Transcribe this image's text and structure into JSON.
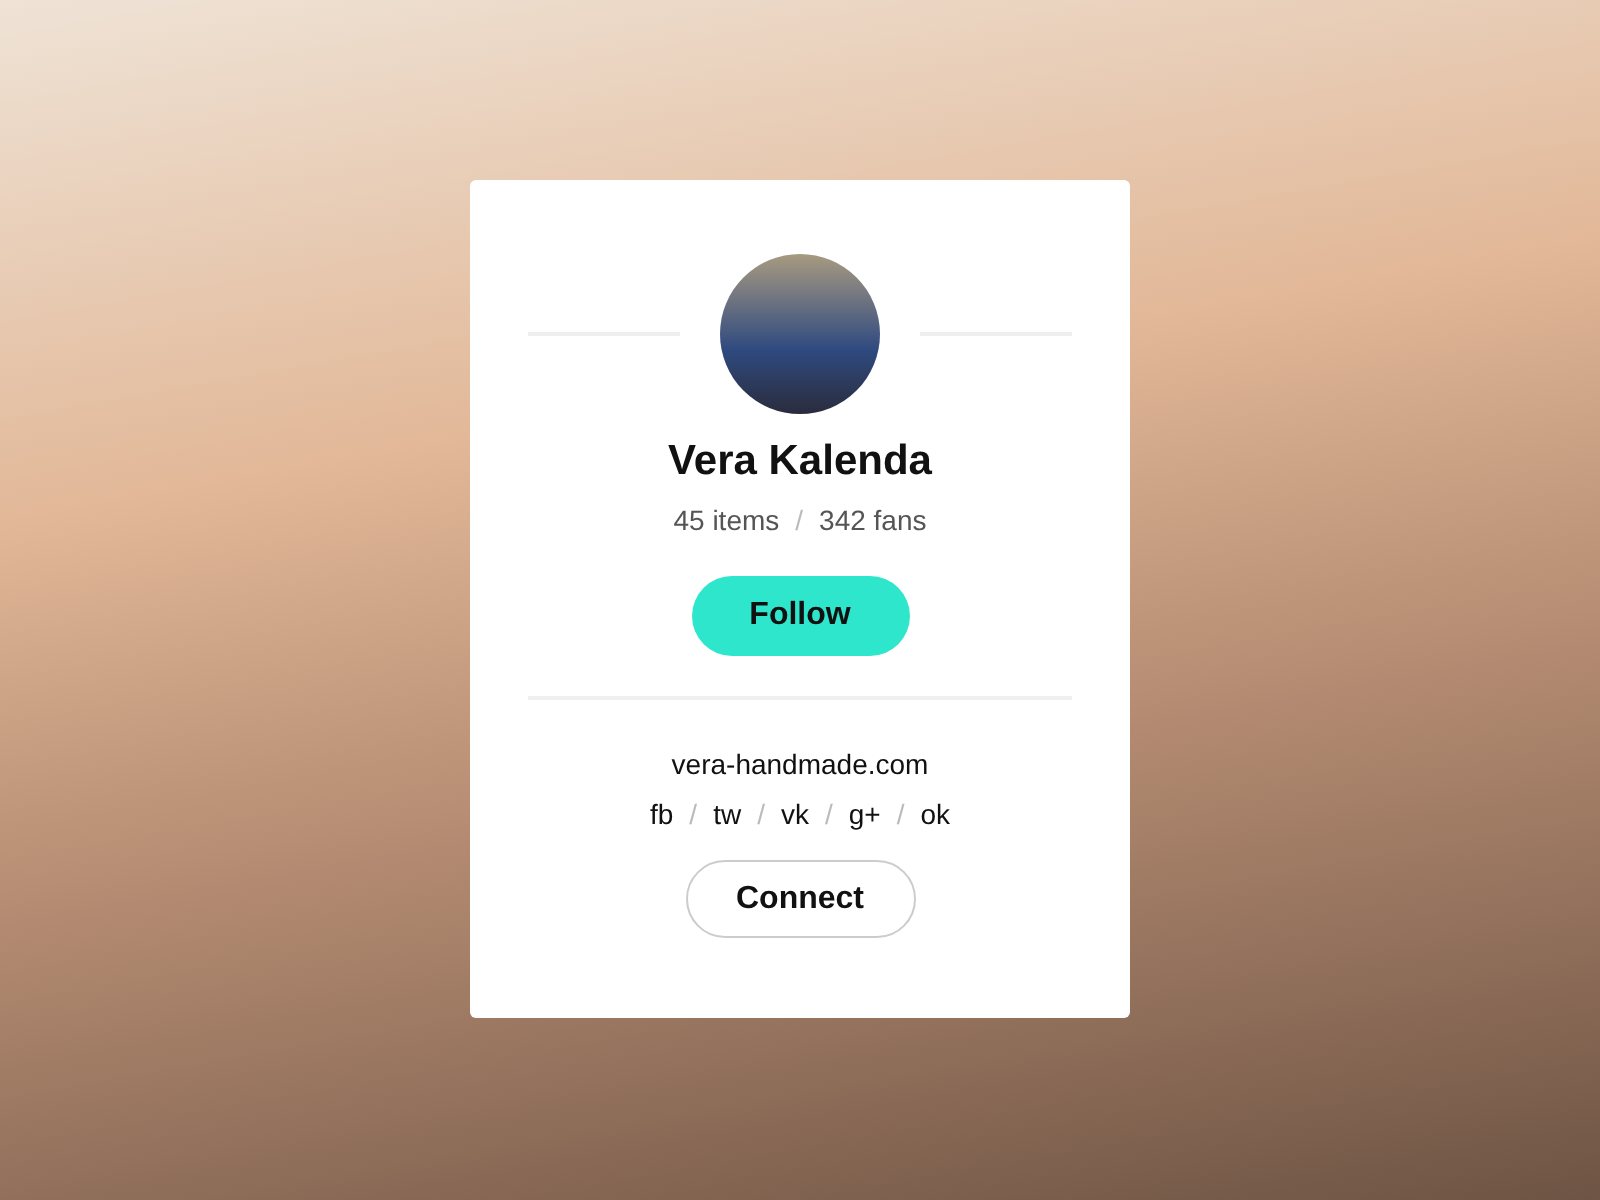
{
  "profile": {
    "name": "Vera Kalenda",
    "stats": [
      {
        "kind": "stat",
        "text": "45 items"
      },
      {
        "kind": "separator",
        "text": "/"
      },
      {
        "kind": "stat",
        "text": "342 fans"
      }
    ],
    "follow_button": "Follow",
    "website": "vera-handmade.com",
    "socials": [
      {
        "kind": "link",
        "text": "fb"
      },
      {
        "kind": "separator",
        "text": "/"
      },
      {
        "kind": "link",
        "text": "tw"
      },
      {
        "kind": "separator",
        "text": "/"
      },
      {
        "kind": "link",
        "text": "vk"
      },
      {
        "kind": "separator",
        "text": "/"
      },
      {
        "kind": "link",
        "text": "g+"
      },
      {
        "kind": "separator",
        "text": "/"
      },
      {
        "kind": "link",
        "text": "ok"
      }
    ],
    "connect_button": "Connect"
  }
}
